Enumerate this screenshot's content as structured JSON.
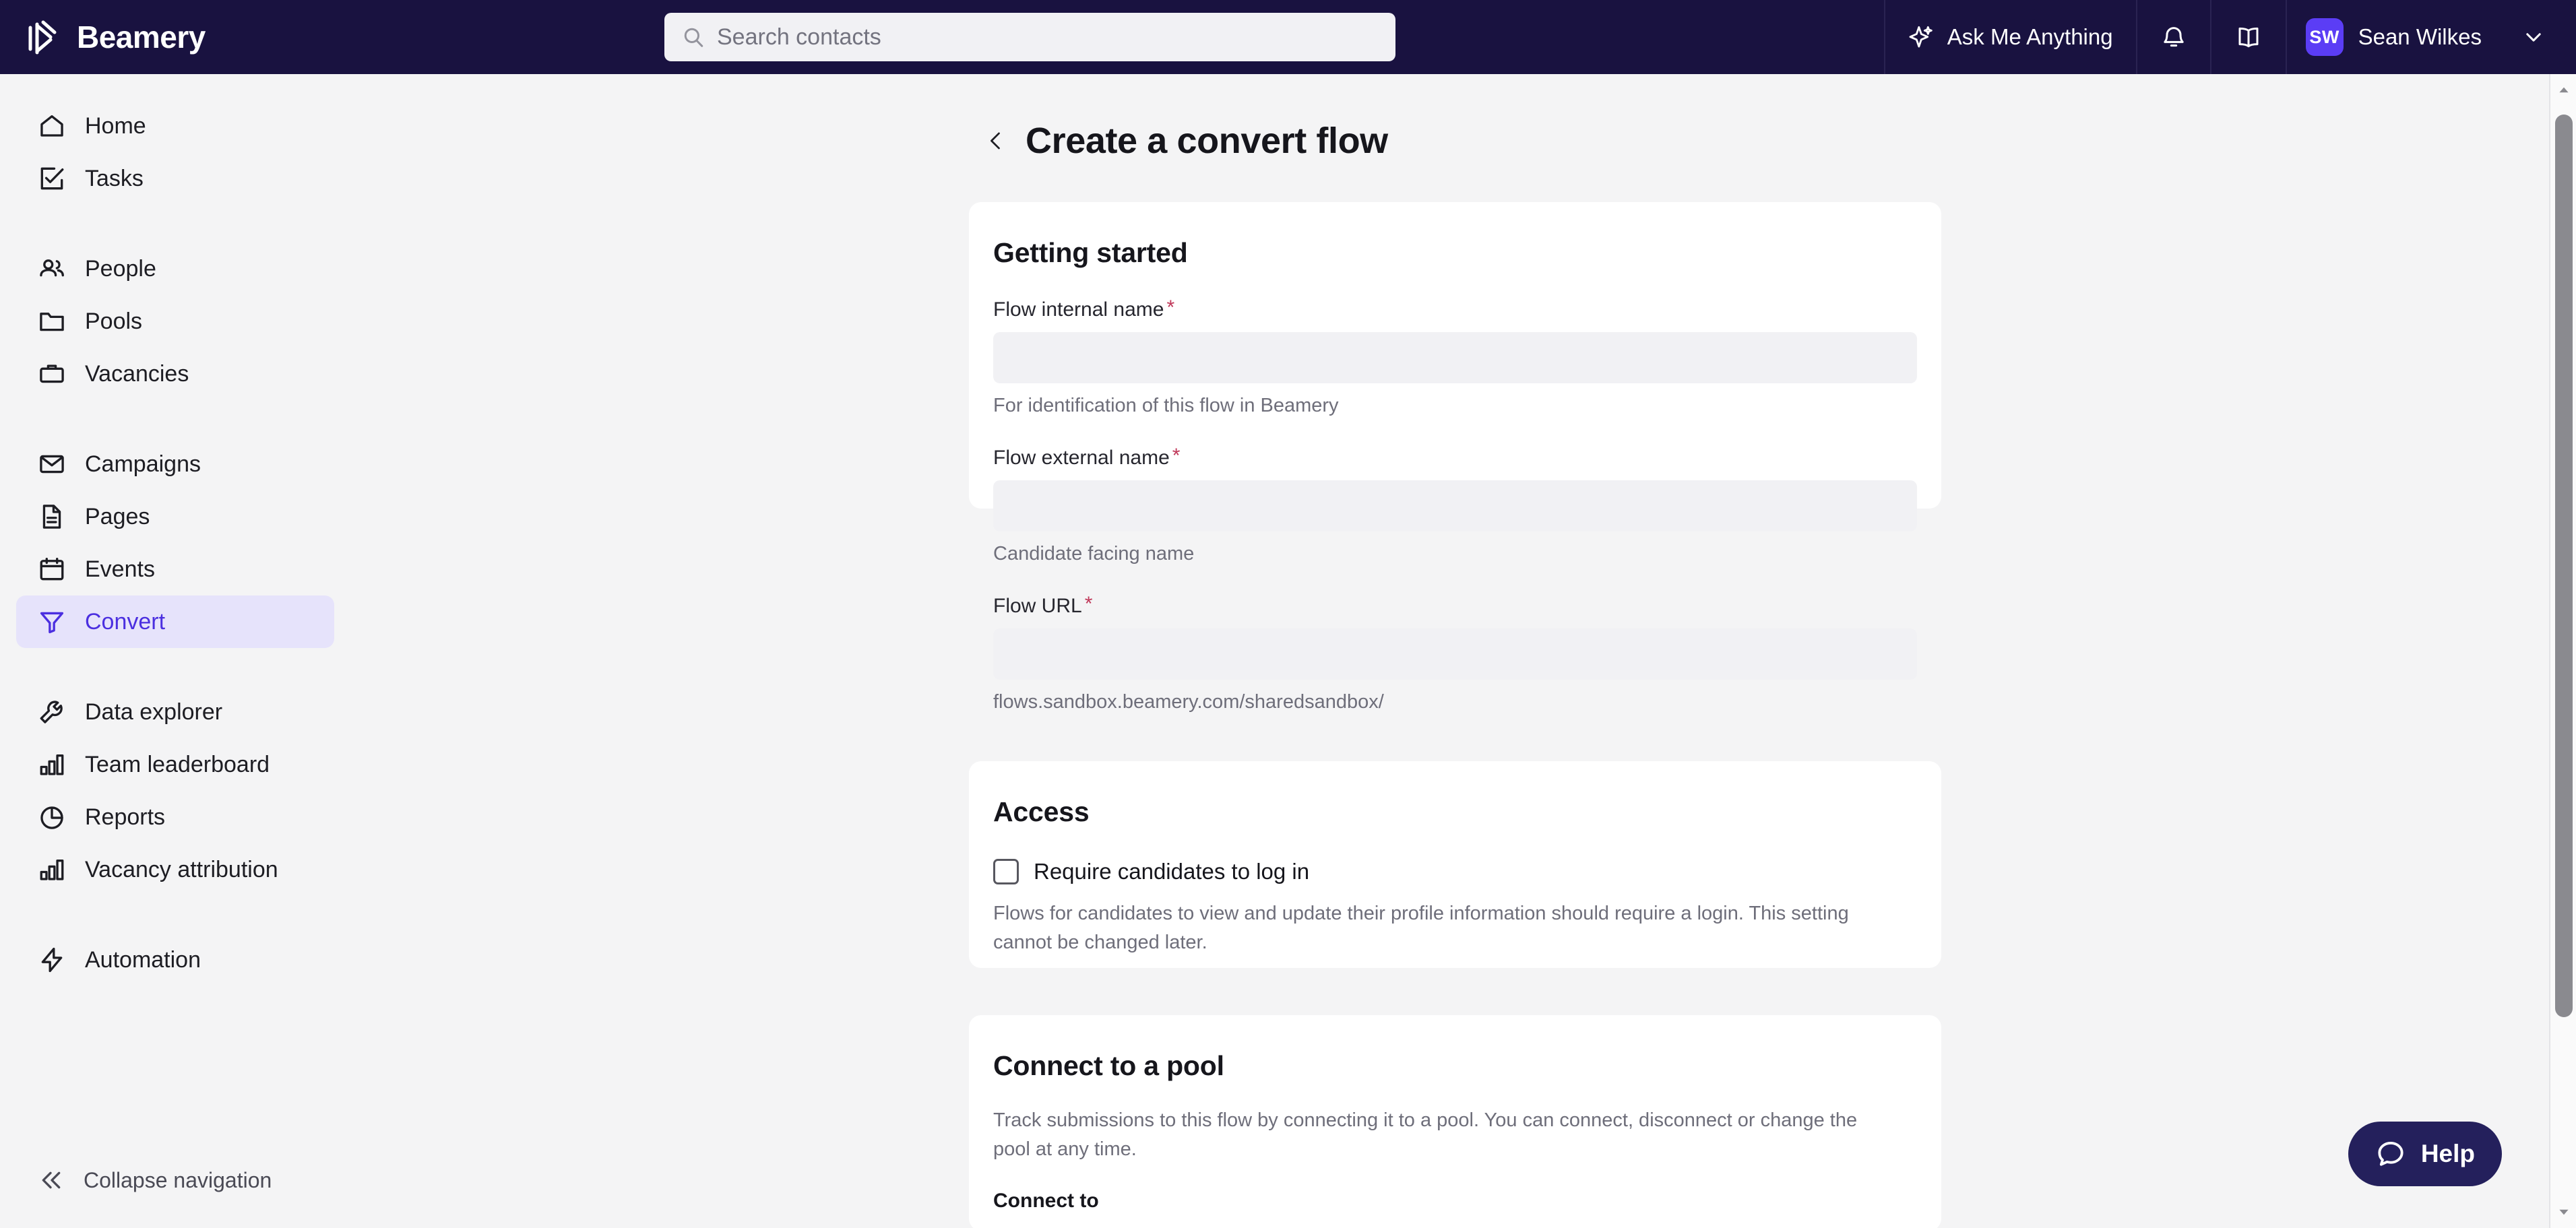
{
  "topbar": {
    "brand_name": "Beamery",
    "brand_logo_icon": "beamery-logo-icon",
    "search": {
      "placeholder": "Search contacts",
      "value": "",
      "icon": "search-icon"
    },
    "ask_me_anything": {
      "label": "Ask Me Anything",
      "icon": "sparkle-icon"
    },
    "notifications_icon": "bell-icon",
    "knowledge_icon": "book-icon",
    "account": {
      "initials": "SW",
      "name": "Sean Wilkes",
      "caret_icon": "chevron-down-icon"
    }
  },
  "sidebar": {
    "groups": [
      {
        "items": [
          {
            "label": "Home",
            "icon": "home-icon",
            "active": false
          },
          {
            "label": "Tasks",
            "icon": "task-check-icon",
            "active": false
          }
        ]
      },
      {
        "items": [
          {
            "label": "People",
            "icon": "people-icon",
            "active": false
          },
          {
            "label": "Pools",
            "icon": "folder-icon",
            "active": false
          },
          {
            "label": "Vacancies",
            "icon": "briefcase-icon",
            "active": false
          }
        ]
      },
      {
        "items": [
          {
            "label": "Campaigns",
            "icon": "envelope-icon",
            "active": false
          },
          {
            "label": "Pages",
            "icon": "document-icon",
            "active": false
          },
          {
            "label": "Events",
            "icon": "calendar-icon",
            "active": false
          },
          {
            "label": "Convert",
            "icon": "funnel-icon",
            "active": true
          }
        ]
      },
      {
        "items": [
          {
            "label": "Data explorer",
            "icon": "wrench-icon",
            "active": false
          },
          {
            "label": "Team leaderboard",
            "icon": "bar-chart-icon",
            "active": false
          },
          {
            "label": "Reports",
            "icon": "pie-chart-icon",
            "active": false
          },
          {
            "label": "Vacancy attribution",
            "icon": "bar-chart-icon",
            "active": false
          }
        ]
      },
      {
        "items": [
          {
            "label": "Automation",
            "icon": "lightning-icon",
            "active": false
          }
        ]
      }
    ],
    "collapse": {
      "label": "Collapse navigation",
      "icon": "double-chevron-left-icon"
    }
  },
  "page": {
    "back_icon": "chevron-left-icon",
    "title": "Create a convert flow",
    "cards": {
      "getting_started": {
        "title": "Getting started",
        "fields": [
          {
            "label": "Flow internal name",
            "required_marker": "*",
            "value": "",
            "placeholder": "",
            "help": "For identification of this flow in Beamery"
          },
          {
            "label": "Flow external name",
            "required_marker": "*",
            "value": "",
            "placeholder": "",
            "help": "Candidate facing name"
          },
          {
            "label": "Flow URL",
            "required_marker": "*",
            "value": "",
            "placeholder": "",
            "help": "flows.sandbox.beamery.com/sharedsandbox/"
          }
        ]
      },
      "access": {
        "title": "Access",
        "checkbox_label": "Require candidates to log in",
        "checked": false,
        "description": "Flows for candidates to view and update their profile information should require a login. This setting cannot be changed later."
      },
      "connect_pool": {
        "title": "Connect to a pool",
        "description": "Track submissions to this flow by connecting it to a pool. You can connect, disconnect or change the pool at any time.",
        "connect_to_label": "Connect to"
      }
    }
  },
  "help_widget": {
    "label": "Help",
    "icon": "chat-bubble-icon"
  },
  "scrollbar": {
    "up_icon": "triangle-up-icon",
    "down_icon": "triangle-down-icon"
  },
  "colors": {
    "topbar_bg": "#191240",
    "page_bg": "#F4F4F5",
    "card_bg": "#FFFFFF",
    "accent": "#4B2FE0",
    "accent_soft": "#E6E3FB",
    "avatar": "#5B3DF5",
    "required": "#C0395A",
    "help_bg": "#24205C",
    "input_bg": "#F1F1F4"
  }
}
